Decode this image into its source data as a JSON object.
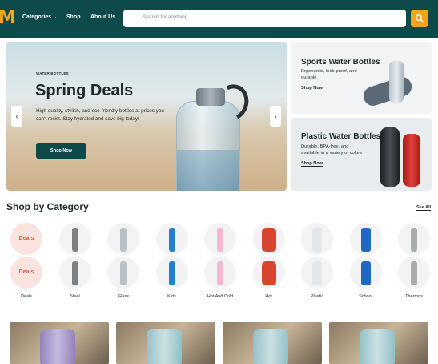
{
  "header": {
    "logo": "M",
    "nav": [
      {
        "label": "Categories",
        "has_dropdown": true
      },
      {
        "label": "Shop"
      },
      {
        "label": "About Us"
      }
    ],
    "search_placeholder": "Search for anything",
    "search_icon": "search-icon"
  },
  "hero": {
    "eyebrow": "WATER BOTTLES",
    "title": "Spring Deals",
    "description": "High-quality, stylish, and eco-friendly bottles at prices you can't resist. Stay hydrated and save big today!",
    "cta": "Shop Now",
    "prev": "‹",
    "next": "›"
  },
  "promos": [
    {
      "title": "Sports Water Bottles",
      "description": "Ergonomic, leak-proof, and durable",
      "link": "Shop Now"
    },
    {
      "title": "Plastic Water Bottles",
      "description": "Durable, BPA-free, and available in a variety of colors",
      "link": "Shop Now"
    }
  ],
  "categories_section": {
    "title": "Shop by Category",
    "see_all": "See All",
    "deals_badge": "Deals",
    "items": [
      {
        "label": "Deals"
      },
      {
        "label": "Steel",
        "color": "#7d7f80"
      },
      {
        "label": "Glass",
        "color": "#b9c2c6"
      },
      {
        "label": "Kids",
        "color": "#1f7fd0"
      },
      {
        "label": "Hot And Cold",
        "color": "#f3b8cf"
      },
      {
        "label": "Hot",
        "color": "#d8452f"
      },
      {
        "label": "Plastic",
        "color": "#e3e7ea"
      },
      {
        "label": "School",
        "color": "#2467c0"
      },
      {
        "label": "Thermos",
        "color": "#a9adb0"
      }
    ]
  },
  "colors": {
    "header_bg": "#0f4a4a",
    "accent": "#f5a31a",
    "deals_bg": "#fbe3e0",
    "deals_text": "#e0553b"
  }
}
